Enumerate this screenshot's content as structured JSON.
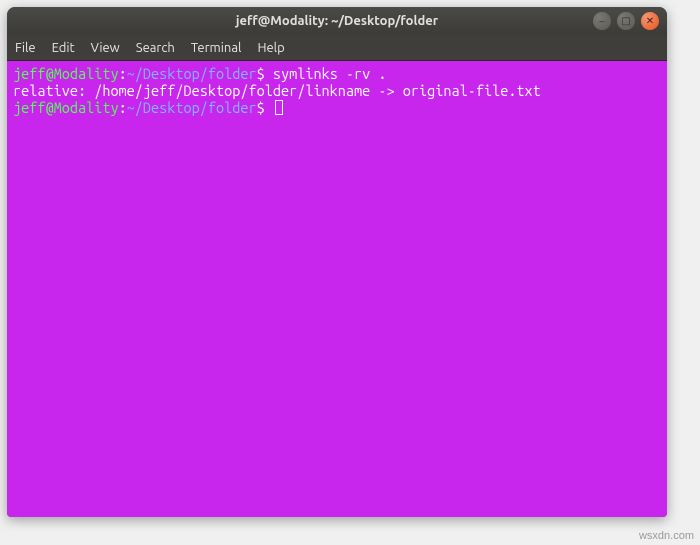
{
  "window": {
    "title": "jeff@Modality: ~/Desktop/folder"
  },
  "controls": {
    "minimize": "–",
    "maximize": "□",
    "close": "✕"
  },
  "menu": {
    "file": "File",
    "edit": "Edit",
    "view": "View",
    "search": "Search",
    "terminal": "Terminal",
    "help": "Help"
  },
  "terminal": {
    "lines": [
      {
        "ps_user": "jeff@Modality",
        "ps_colon": ":",
        "ps_path": "~/Desktop/folder",
        "ps_dollar": "$",
        "command": " symlinks -rv ."
      },
      {
        "output": "relative: /home/jeff/Desktop/folder/linkname -> original-file.txt"
      },
      {
        "ps_user": "jeff@Modality",
        "ps_colon": ":",
        "ps_path": "~/Desktop/folder",
        "ps_dollar": "$",
        "command": " "
      }
    ]
  },
  "watermark": "wsxdn.com"
}
